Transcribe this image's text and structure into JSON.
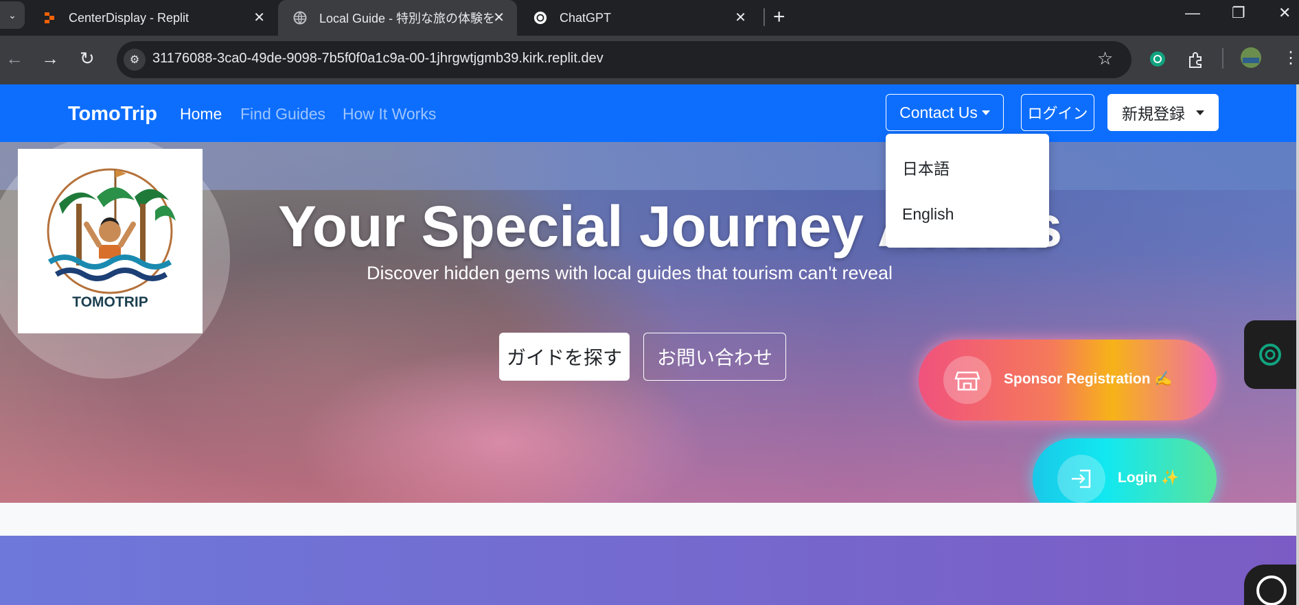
{
  "browser": {
    "tabs": [
      {
        "title": "CenterDisplay - Replit",
        "close": "✕"
      },
      {
        "title": "Local Guide - 特別な旅の体験を",
        "close": "✕"
      },
      {
        "title": "ChatGPT",
        "close": "✕"
      }
    ],
    "new_tab": "+",
    "url": "31176088-3ca0-49de-9098-7b5f0f0a1c9a-00-1jhrgwtjgmb39.kirk.replit.dev"
  },
  "navbar": {
    "brand": "TomoTrip",
    "links": [
      "Home",
      "Find Guides",
      "How It Works"
    ],
    "contact": "Contact Us",
    "login": "ログイン",
    "register": "新規登録"
  },
  "dropdown": {
    "items": [
      "日本語",
      "English"
    ]
  },
  "hero": {
    "logo_text": "TOMOTRIP",
    "title": "Your Special Journey Awaits",
    "subtitle": "Discover hidden gems with local guides that tourism can't reveal",
    "btn_find": "ガイドを探す",
    "btn_contact": "お問い合わせ",
    "sponsor": "Sponsor Registration ✍️",
    "login": "Login ✨"
  },
  "colors": {
    "navbar": "#0d6efd",
    "sponsor_gradient_start": "#f0527d",
    "login_gradient_start": "#19c8e8"
  }
}
